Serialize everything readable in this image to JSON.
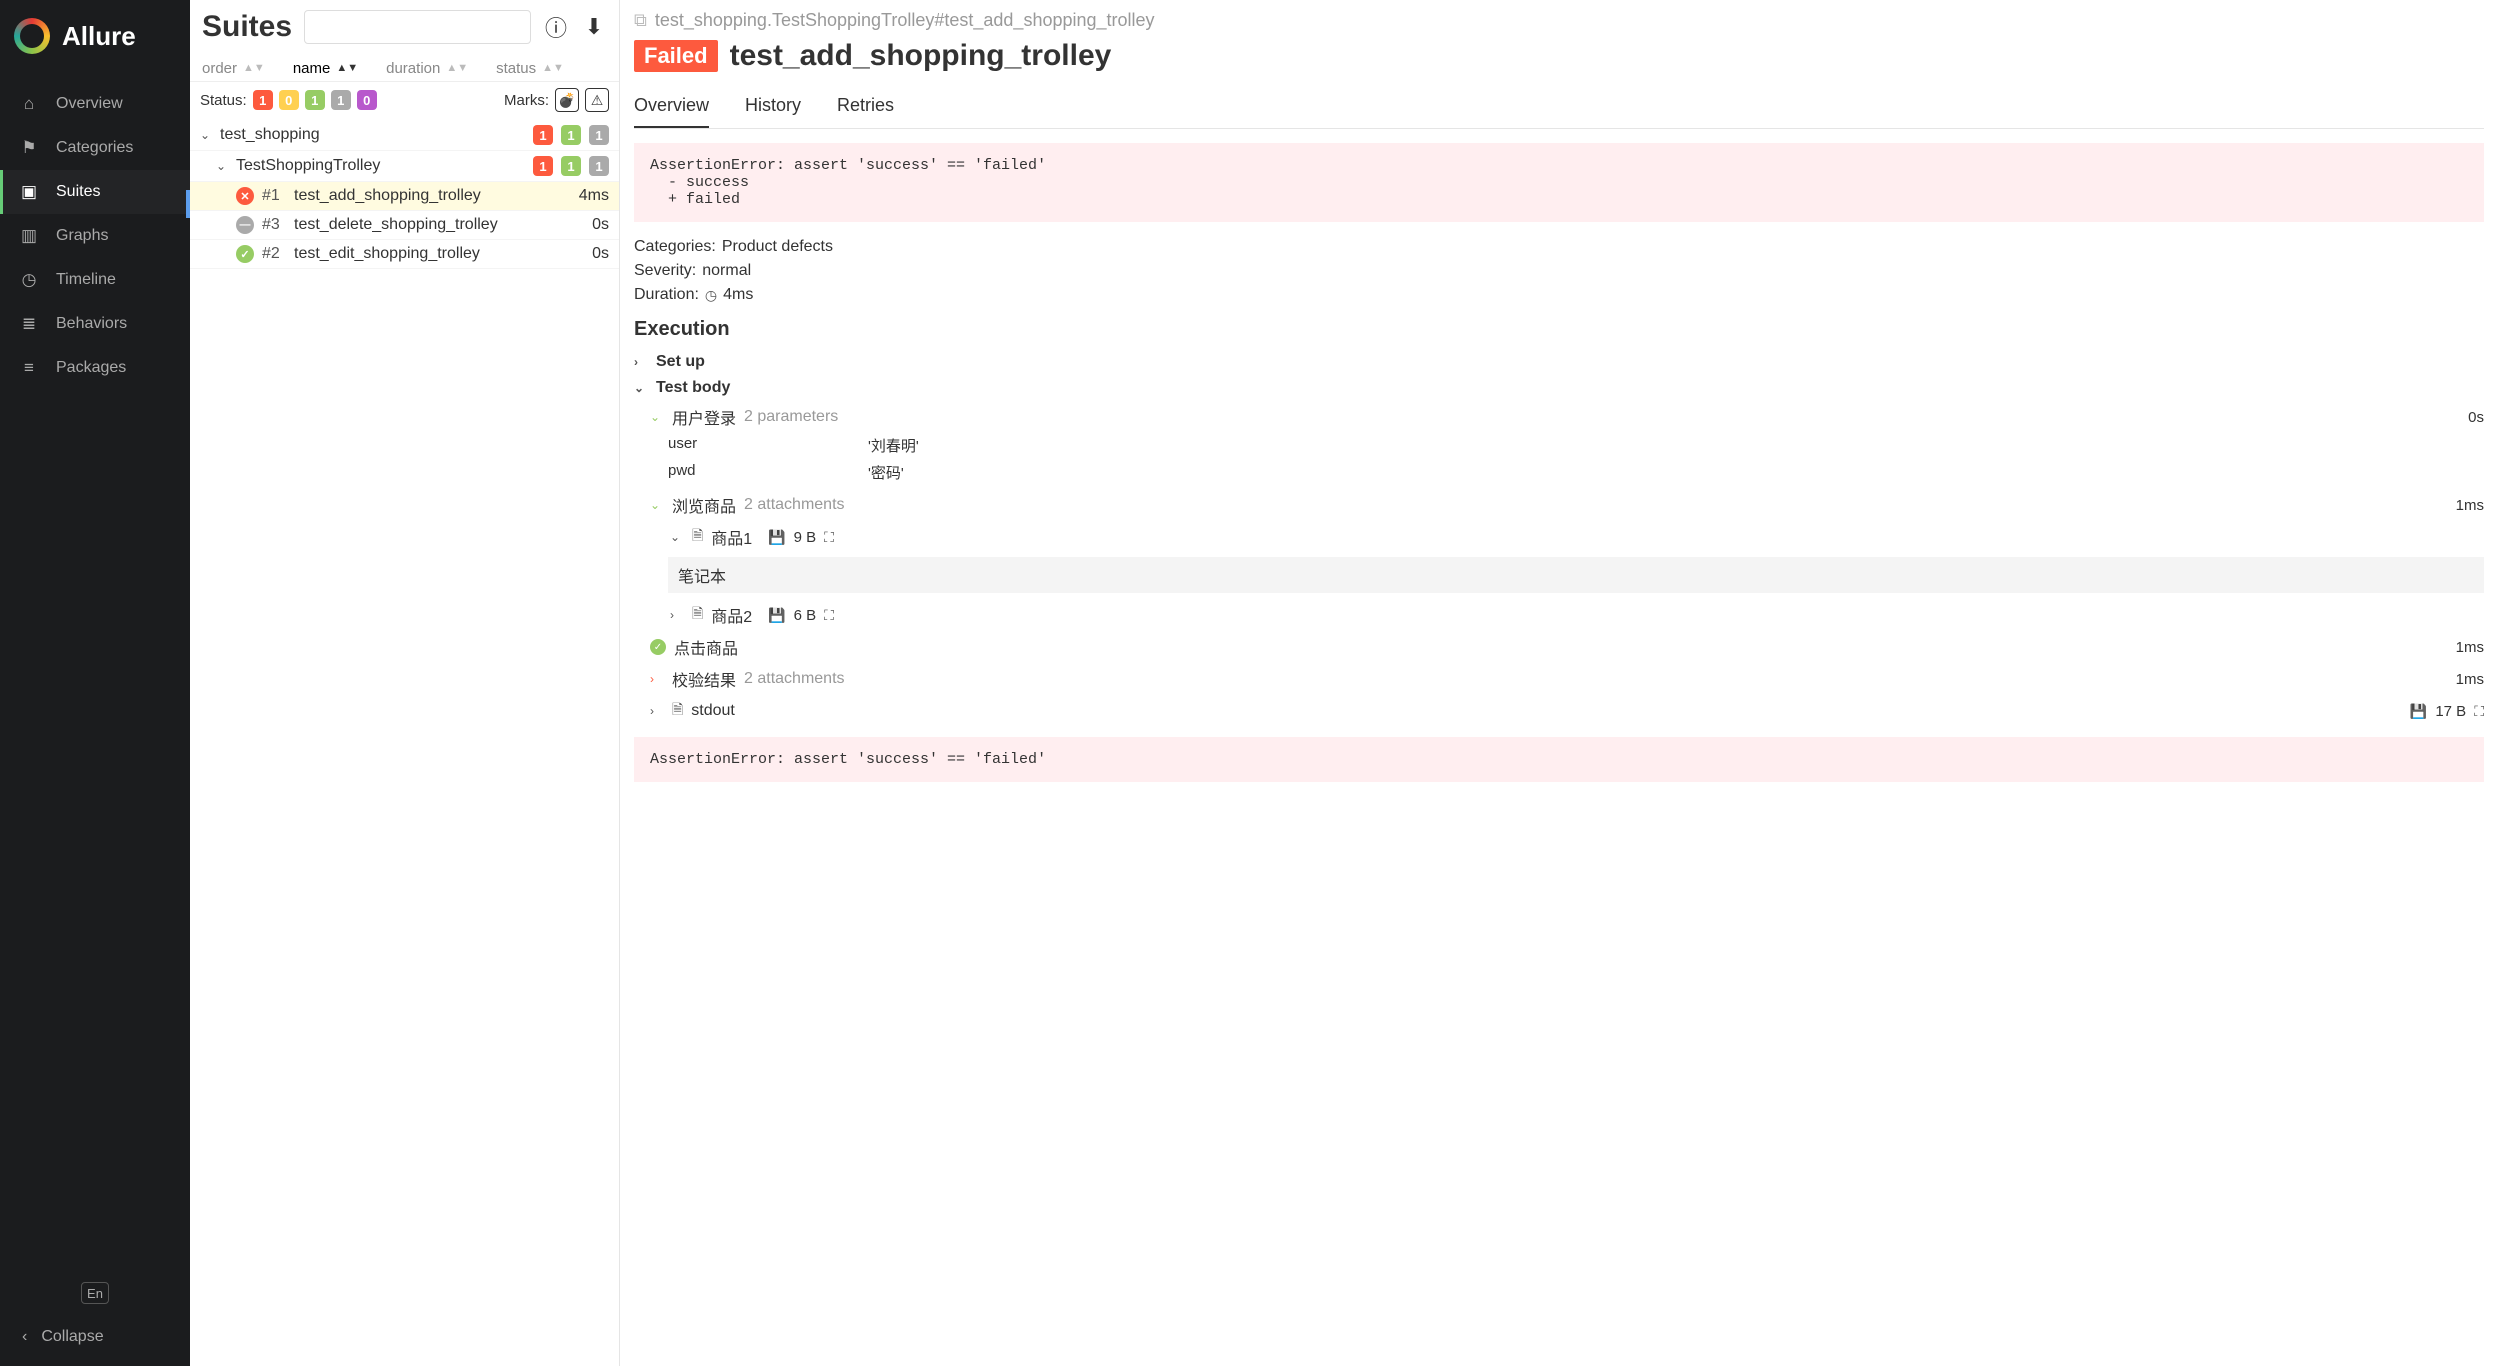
{
  "brand": {
    "name": "Allure"
  },
  "nav": {
    "overview": "Overview",
    "categories": "Categories",
    "suites": "Suites",
    "graphs": "Graphs",
    "timeline": "Timeline",
    "behaviors": "Behaviors",
    "packages": "Packages"
  },
  "lang": "En",
  "collapse": "Collapse",
  "middle": {
    "title": "Suites",
    "sort": {
      "order": "order",
      "name": "name",
      "duration": "duration",
      "status": "status"
    },
    "status_label": "Status:",
    "marks_label": "Marks:",
    "counts": {
      "failed": "1",
      "broken": "0",
      "passed": "1",
      "skipped": "1",
      "unknown": "0"
    },
    "tree": {
      "suite": {
        "name": "test_shopping",
        "c1": "1",
        "c2": "1",
        "c3": "1"
      },
      "cls": {
        "name": "TestShoppingTrolley",
        "c1": "1",
        "c2": "1",
        "c3": "1"
      },
      "t1": {
        "num": "#1",
        "name": "test_add_shopping_trolley",
        "time": "4ms"
      },
      "t2": {
        "num": "#3",
        "name": "test_delete_shopping_trolley",
        "time": "0s"
      },
      "t3": {
        "num": "#2",
        "name": "test_edit_shopping_trolley",
        "time": "0s"
      }
    }
  },
  "detail": {
    "path": "test_shopping.TestShoppingTrolley#test_add_shopping_trolley",
    "status_badge": "Failed",
    "title": "test_add_shopping_trolley",
    "tabs": {
      "overview": "Overview",
      "history": "History",
      "retries": "Retries"
    },
    "error": "AssertionError: assert 'success' == 'failed'\n  - success\n  + failed",
    "categories_label": "Categories:",
    "categories_value": "Product defects",
    "severity_label": "Severity:",
    "severity_value": "normal",
    "duration_label": "Duration:",
    "duration_value": "4ms",
    "execution": "Execution",
    "setup": "Set up",
    "testbody": "Test body",
    "step1": {
      "name": "用户登录",
      "params": "2 parameters",
      "time": "0s",
      "p1k": "user",
      "p1v": "'刘春明'",
      "p2k": "pwd",
      "p2v": "'密码'"
    },
    "step2": {
      "name": "浏览商品",
      "att": "2 attachments",
      "time": "1ms",
      "a1": "商品1",
      "a1s": "9 B",
      "a1c": "笔记本",
      "a2": "商品2",
      "a2s": "6 B"
    },
    "step3": {
      "name": "点击商品",
      "time": "1ms"
    },
    "step4": {
      "name": "校验结果",
      "att": "2 attachments",
      "time": "1ms"
    },
    "stdout": {
      "name": "stdout",
      "size": "17 B"
    },
    "error2": "AssertionError: assert 'success' == 'failed'"
  }
}
